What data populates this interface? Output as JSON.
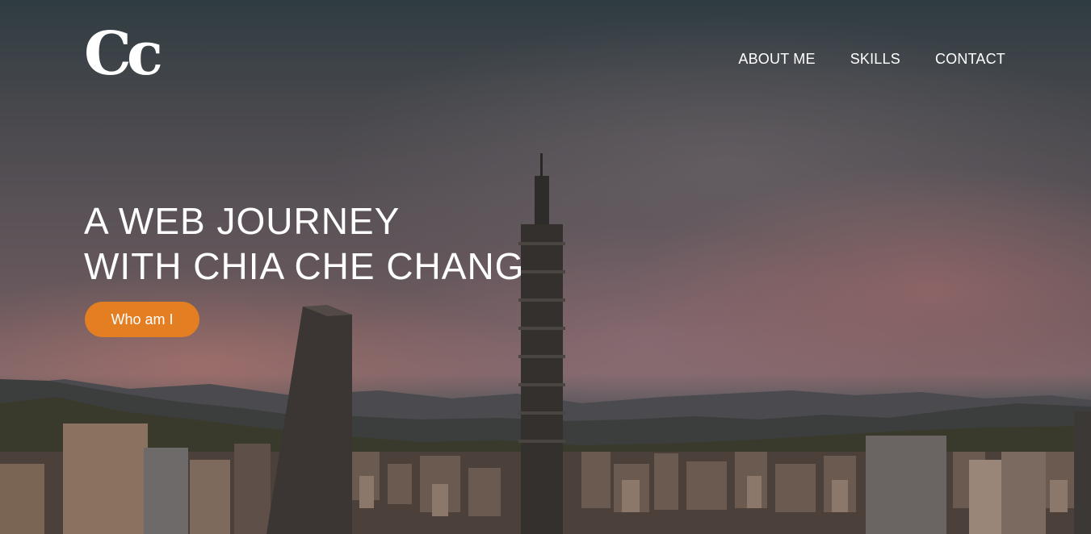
{
  "header": {
    "logo_text": "Cc",
    "nav": [
      {
        "label": "ABOUT ME"
      },
      {
        "label": "SKILLS"
      },
      {
        "label": "CONTACT"
      }
    ]
  },
  "hero": {
    "headline_line1": "A WEB JOURNEY",
    "headline_line2": "WITH CHIA CHE CHANG",
    "cta_label": "Who am I"
  },
  "colors": {
    "accent": "#e37f22",
    "text": "#ffffff"
  }
}
